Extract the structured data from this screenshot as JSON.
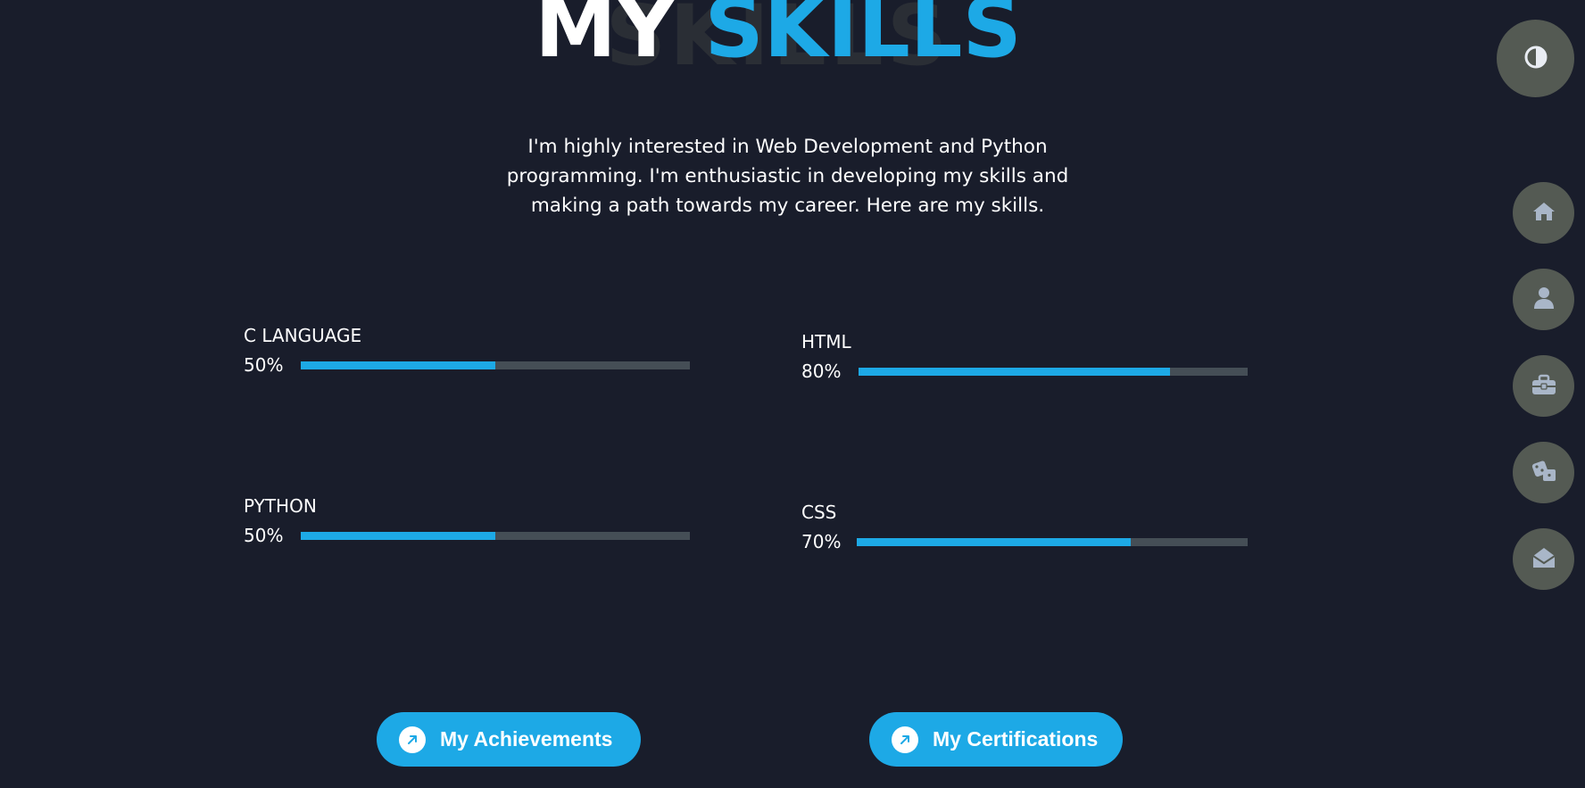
{
  "heading": {
    "word1": "MY",
    "word2": "SKILLS",
    "background_text": "SKILLS"
  },
  "intro": {
    "text": "I'm highly interested in Web Development and Python programming. I'm enthusiastic in developing my skills and making a path towards my career. Here are my skills."
  },
  "skills": [
    {
      "name": "C LANGUAGE",
      "percent_label": "50%",
      "level": 0.5
    },
    {
      "name": "HTML",
      "percent_label": "80%",
      "level": 0.8
    },
    {
      "name": "PYTHON",
      "percent_label": "50%",
      "level": 0.5
    },
    {
      "name": "CSS",
      "percent_label": "70%",
      "level": 0.7
    }
  ],
  "buttons": {
    "achievements": {
      "label": "My Achievements",
      "icon": "arrow-up-right-icon"
    },
    "certifications": {
      "label": "My Certifications",
      "icon": "arrow-up-right-icon"
    }
  },
  "side_nav": {
    "theme_toggle_icon": "contrast-icon",
    "items": [
      {
        "icon": "home-icon"
      },
      {
        "icon": "user-icon"
      },
      {
        "icon": "briefcase-icon"
      },
      {
        "icon": "dice-icon"
      },
      {
        "icon": "envelope-open-icon"
      }
    ]
  },
  "colors": {
    "background": "#191d2b",
    "accent": "#1da9e6",
    "track": "#454e56",
    "nav_button": "#545a53",
    "nav_icon": "#a9b6c8"
  }
}
